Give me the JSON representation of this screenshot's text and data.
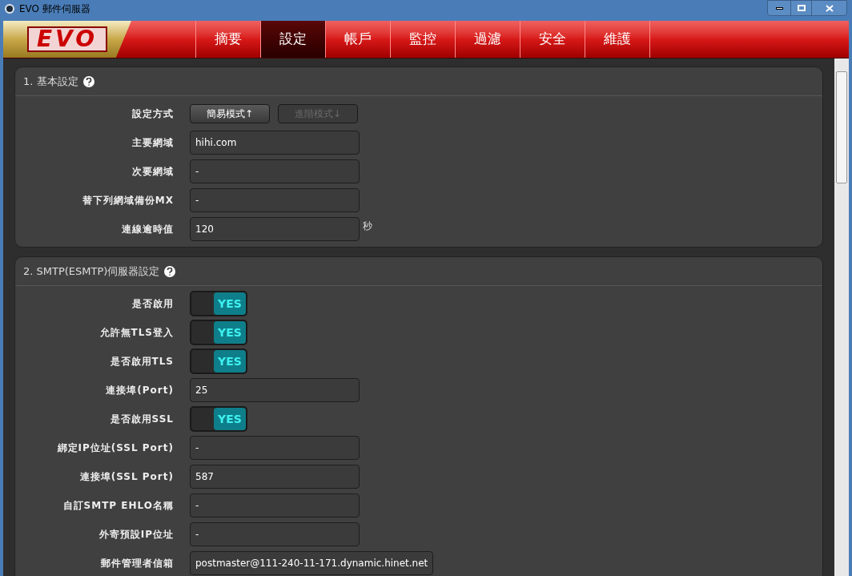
{
  "window": {
    "title": "EVO 郵件伺服器"
  },
  "logo": {
    "text": "EVO"
  },
  "tabs": [
    {
      "label": "摘要",
      "selected": false
    },
    {
      "label": "設定",
      "selected": true
    },
    {
      "label": "帳戶",
      "selected": false
    },
    {
      "label": "監控",
      "selected": false
    },
    {
      "label": "過濾",
      "selected": false
    },
    {
      "label": "安全",
      "selected": false
    },
    {
      "label": "維護",
      "selected": false
    }
  ],
  "sections": [
    {
      "title": "1. 基本設定",
      "rows": [
        {
          "kind": "buttons",
          "label": "設定方式",
          "buttons": [
            {
              "label": "簡易模式↑",
              "selected": true
            },
            {
              "label": "進階模式↓",
              "selected": false
            }
          ]
        },
        {
          "kind": "field",
          "label": "主要網域",
          "value": "hihi.com"
        },
        {
          "kind": "field",
          "label": "次要網域",
          "value": "-"
        },
        {
          "kind": "field",
          "label": "替下列網域備份MX",
          "value": "-"
        },
        {
          "kind": "field",
          "label": "連線逾時值",
          "value": "120",
          "unit": "秒"
        }
      ]
    },
    {
      "title": "2. SMTP(ESMTP)伺服器設定",
      "rows": [
        {
          "kind": "toggle",
          "label": "是否啟用",
          "text": "YES",
          "on": true
        },
        {
          "kind": "toggle",
          "label": "允許無TLS登入",
          "text": "YES",
          "on": true
        },
        {
          "kind": "toggle",
          "label": "是否啟用TLS",
          "text": "YES",
          "on": true
        },
        {
          "kind": "field",
          "label": "連接埠(Port)",
          "value": "25"
        },
        {
          "kind": "toggle",
          "label": "是否啟用SSL",
          "text": "YES",
          "on": true
        },
        {
          "kind": "field",
          "label": "綁定IP位址(SSL Port)",
          "value": "-"
        },
        {
          "kind": "field",
          "label": "連接埠(SSL Port)",
          "value": "587"
        },
        {
          "kind": "field",
          "label": "自訂SMTP EHLO名稱",
          "value": "-"
        },
        {
          "kind": "field",
          "label": "外寄預設IP位址",
          "value": "-"
        },
        {
          "kind": "field",
          "label": "郵件管理者信箱",
          "value": "postmaster@111-240-11-171.dynamic.hinet.net"
        }
      ]
    }
  ]
}
